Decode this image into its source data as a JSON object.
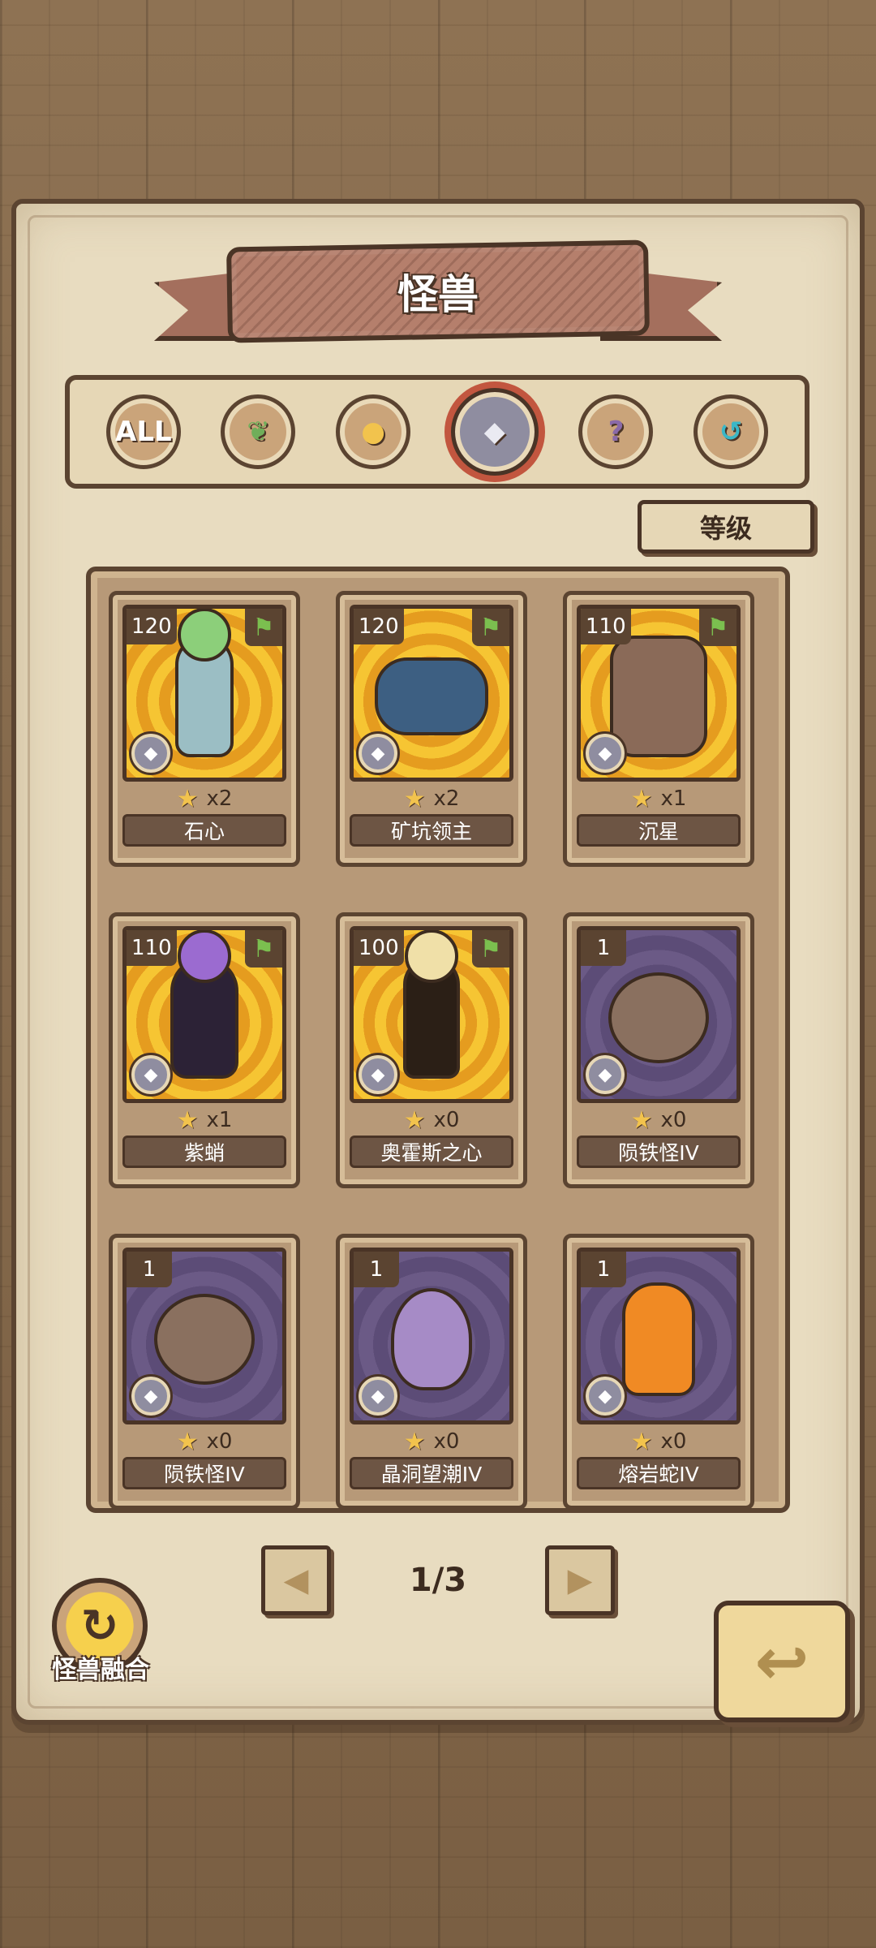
{
  "header": {
    "title": "怪兽"
  },
  "filters": [
    {
      "id": "all",
      "label": "ALL",
      "icon": "all-icon",
      "active": false
    },
    {
      "id": "plant",
      "label": "",
      "icon": "leaf-icon",
      "active": false
    },
    {
      "id": "beast",
      "label": "",
      "icon": "paw-icon",
      "active": false
    },
    {
      "id": "mineral",
      "label": "",
      "icon": "crystal-icon",
      "active": true
    },
    {
      "id": "unknown",
      "label": "",
      "icon": "question-icon",
      "active": false
    },
    {
      "id": "mech",
      "label": "",
      "icon": "hook-icon",
      "active": false
    }
  ],
  "sort": {
    "label": "等级"
  },
  "cards": [
    {
      "level": "120",
      "stars": "x2",
      "name": "石心",
      "flag": true,
      "bg": "gold",
      "art": "m-human"
    },
    {
      "level": "120",
      "stars": "x2",
      "name": "矿坑领主",
      "flag": true,
      "bg": "gold",
      "art": "m-golem"
    },
    {
      "level": "110",
      "stars": "x1",
      "name": "沉星",
      "flag": true,
      "bg": "gold",
      "art": "m-stone"
    },
    {
      "level": "110",
      "stars": "x1",
      "name": "紫蛸",
      "flag": true,
      "bg": "gold",
      "art": "m-girl"
    },
    {
      "level": "100",
      "stars": "x0",
      "name": "奥霍斯之心",
      "flag": true,
      "bg": "gold",
      "art": "m-fire"
    },
    {
      "level": "1",
      "stars": "x0",
      "name": "陨铁怪IV",
      "flag": false,
      "bg": "purple",
      "art": "m-rock"
    },
    {
      "level": "1",
      "stars": "x0",
      "name": "陨铁怪IV",
      "flag": false,
      "bg": "purple",
      "art": "m-rock"
    },
    {
      "level": "1",
      "stars": "x0",
      "name": "晶洞望潮IV",
      "flag": false,
      "bg": "purple",
      "art": "m-crystal"
    },
    {
      "level": "1",
      "stars": "x0",
      "name": "熔岩蛇IV",
      "flag": false,
      "bg": "purple",
      "art": "m-lava"
    }
  ],
  "pagination": {
    "current": "1/3"
  },
  "fusion": {
    "label": "怪兽融合"
  }
}
